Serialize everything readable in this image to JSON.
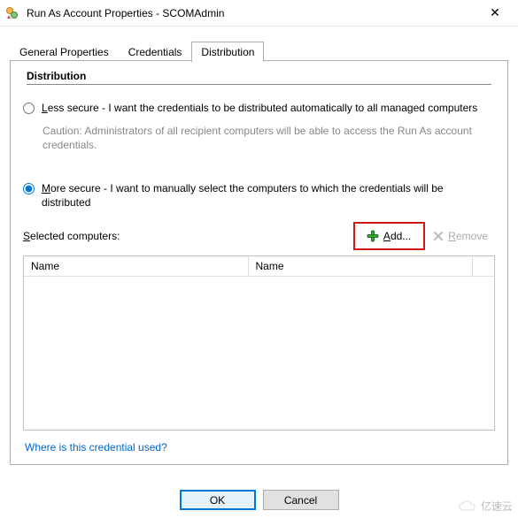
{
  "window": {
    "title": "Run As Account Properties - SCOMAdmin",
    "close_glyph": "✕"
  },
  "tabs": {
    "general": "General Properties",
    "credentials": "Credentials",
    "distribution": "Distribution"
  },
  "distribution": {
    "section_title": "Distribution",
    "less_secure": {
      "prefix": "L",
      "rest": "ess secure - I want the credentials to be distributed automatically to all managed computers",
      "caution": "Caution: Administrators of all recipient computers will be able to access the Run As account credentials."
    },
    "more_secure": {
      "prefix": "M",
      "rest": "ore secure - I want to manually select the computers to which the credentials will be distributed"
    },
    "selected_label_prefix": "S",
    "selected_label_rest": "elected computers:",
    "add_label_prefix": "A",
    "add_label_rest": "dd...",
    "remove_label_prefix": "R",
    "remove_label_rest": "emove",
    "columns": {
      "name1": "Name",
      "name2": "Name"
    },
    "link": "Where is this credential used?"
  },
  "buttons": {
    "ok": "OK",
    "cancel": "Cancel"
  },
  "watermark": "亿速云"
}
